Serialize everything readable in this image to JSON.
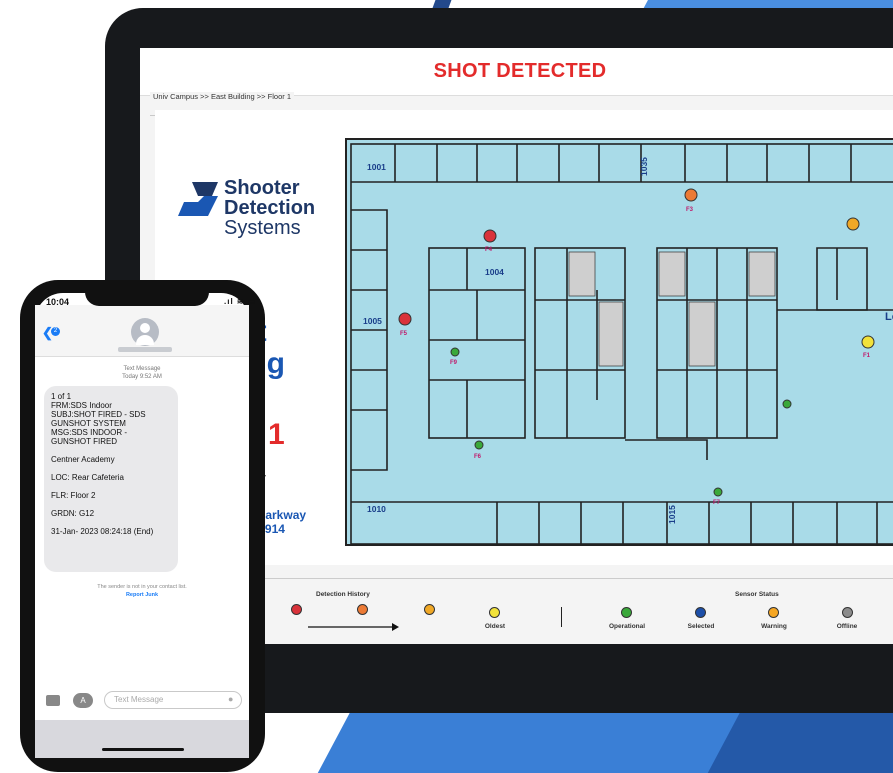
{
  "dashboard": {
    "banner_title": "SHOT DETECTED",
    "breadcrumb": "Univ Campus  >>  East Building  >>  Floor 1",
    "brand": {
      "line1": "Shooter",
      "line2": "Detection",
      "line3": "Systems"
    },
    "building_fragments": [
      "st",
      "ing",
      "R 1",
      "sity",
      "gy Parkway",
      "A 31914"
    ],
    "rooms": [
      "1001",
      "1035",
      "1004",
      "1005",
      "1010",
      "1015",
      "Lo"
    ],
    "sensors": [
      {
        "id": "F3",
        "status": "orange"
      },
      {
        "id": "F4",
        "status": "red"
      },
      {
        "id": "F5",
        "status": "red"
      },
      {
        "id": "F9",
        "status": "green"
      },
      {
        "id": "F6",
        "status": "green"
      },
      {
        "id": "F7",
        "status": "green"
      },
      {
        "id": "F1",
        "status": "yellow"
      }
    ],
    "legend": {
      "detection_history_title": "Detection History",
      "oldest_label": "Oldest",
      "sensor_status_title": "Sensor Status",
      "status_labels": [
        "Operational",
        "Selected",
        "Warning",
        "Offline"
      ]
    },
    "colors": {
      "alert_red": "#e32b2b",
      "map_fill": "#a9dbe8",
      "operational": "#3aa83a",
      "selected": "#1d4fa8",
      "warning": "#f5a623",
      "offline": "#8c8c8c",
      "history": [
        "#d9323a",
        "#ec7a35",
        "#f0a826",
        "#f2e23a"
      ]
    }
  },
  "phone": {
    "time": "10:04",
    "status_icons": ".ıl ≋ ▭",
    "back_badge": "2",
    "message_meta_line1": "Text Message",
    "message_meta_line2": "Today 9:52 AM",
    "message": {
      "line1": "1 of 1",
      "line2": "FRM:SDS Indoor",
      "line3": "SUBJ:SHOT FIRED - SDS",
      "line4": "GUNSHOT SYSTEM",
      "line5": "MSG:SDS INDOOR -",
      "line6": "GUNSHOT FIRED",
      "line7": "Centner Academy",
      "line8": "LOC: Rear Cafeteria",
      "line9": "FLR: Floor 2",
      "line10": "GRDN: G12",
      "line11": "31-Jan- 2023 08:24:18 (End)"
    },
    "notice": "The sender is not in your contact list.",
    "report_junk": "Report Junk",
    "composer_placeholder": "Text Message"
  }
}
